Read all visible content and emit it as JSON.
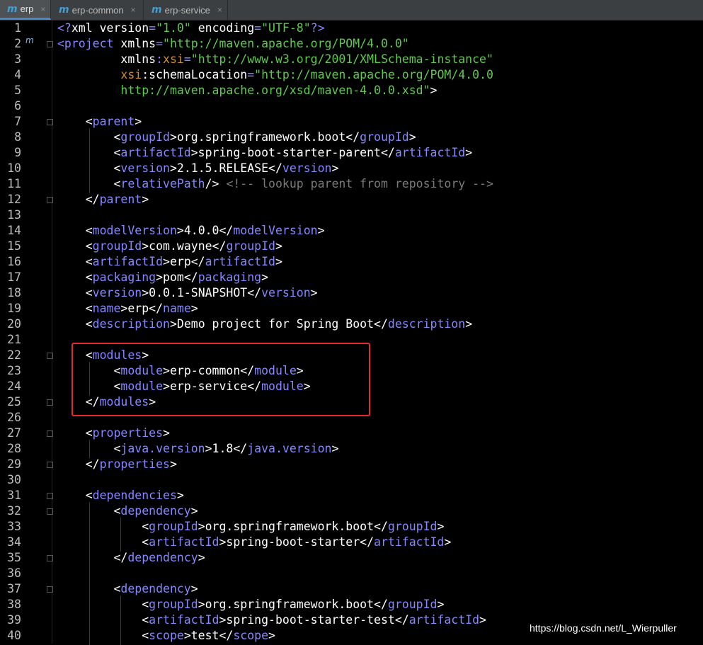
{
  "tabs": [
    {
      "label": "erp",
      "icon": "maven-m-icon",
      "active": true
    },
    {
      "label": "erp-common",
      "icon": "maven-m-icon",
      "active": false
    },
    {
      "label": "erp-service",
      "icon": "maven-m-icon",
      "active": false
    }
  ],
  "close_glyph": "×",
  "gutter_marker": "m",
  "watermark": "https://blog.csdn.net/L_Wierpuller",
  "colors": {
    "background": "#000000",
    "tag": "#8787ff",
    "string": "#5ec94d",
    "namespace": "#d08e3a",
    "comment": "#7a7a7a",
    "highlight": "#e6292b"
  },
  "lines": [
    {
      "n": "1",
      "tokens": [
        {
          "k": "t",
          "x": "<?"
        },
        {
          "k": "a",
          "x": "xml version"
        },
        {
          "k": "t",
          "x": "="
        },
        {
          "k": "s",
          "x": "\"1.0\""
        },
        {
          "k": "a",
          "x": " encoding"
        },
        {
          "k": "t",
          "x": "="
        },
        {
          "k": "s",
          "x": "\"UTF-8\""
        },
        {
          "k": "t",
          "x": "?>"
        }
      ]
    },
    {
      "n": "2",
      "tokens": [
        {
          "k": "t",
          "x": "<project"
        },
        {
          "k": "a",
          "x": " xmlns"
        },
        {
          "k": "t",
          "x": "="
        },
        {
          "k": "s",
          "x": "\"http://maven.apache.org/POM/4.0.0\""
        }
      ]
    },
    {
      "n": "3",
      "tokens": [
        {
          "k": "a",
          "x": "         xmlns"
        },
        {
          "k": "t",
          "x": ":"
        },
        {
          "k": "ns",
          "x": "xsi"
        },
        {
          "k": "t",
          "x": "="
        },
        {
          "k": "s",
          "x": "\"http://www.w3.org/2001/XMLSchema-instance\""
        }
      ]
    },
    {
      "n": "4",
      "tokens": [
        {
          "k": "ns",
          "x": "         xsi"
        },
        {
          "k": "a",
          "x": ":schemaLocation"
        },
        {
          "k": "t",
          "x": "="
        },
        {
          "k": "s",
          "x": "\"http://maven.apache.org/POM/4.0.0"
        }
      ]
    },
    {
      "n": "5",
      "tokens": [
        {
          "k": "s",
          "x": "         http://maven.apache.org/xsd/maven-4.0.0.xsd\""
        },
        {
          "k": "v",
          "x": ">"
        }
      ]
    },
    {
      "n": "6",
      "tokens": []
    },
    {
      "n": "7",
      "tokens": [
        {
          "k": "v",
          "x": "    <"
        },
        {
          "k": "t",
          "x": "parent"
        },
        {
          "k": "v",
          "x": ">"
        }
      ]
    },
    {
      "n": "8",
      "tokens": [
        {
          "k": "v",
          "x": "        <"
        },
        {
          "k": "t",
          "x": "groupId"
        },
        {
          "k": "v",
          "x": ">org.springframework.boot</"
        },
        {
          "k": "t",
          "x": "groupId"
        },
        {
          "k": "v",
          "x": ">"
        }
      ]
    },
    {
      "n": "9",
      "tokens": [
        {
          "k": "v",
          "x": "        <"
        },
        {
          "k": "t",
          "x": "artifactId"
        },
        {
          "k": "v",
          "x": ">spring-boot-starter-parent</"
        },
        {
          "k": "t",
          "x": "artifactId"
        },
        {
          "k": "v",
          "x": ">"
        }
      ]
    },
    {
      "n": "10",
      "tokens": [
        {
          "k": "v",
          "x": "        <"
        },
        {
          "k": "t",
          "x": "version"
        },
        {
          "k": "v",
          "x": ">2.1.5.RELEASE</"
        },
        {
          "k": "t",
          "x": "version"
        },
        {
          "k": "v",
          "x": ">"
        }
      ]
    },
    {
      "n": "11",
      "tokens": [
        {
          "k": "v",
          "x": "        <"
        },
        {
          "k": "t",
          "x": "relativePath"
        },
        {
          "k": "v",
          "x": "/> "
        },
        {
          "k": "c",
          "x": "<!-- lookup parent from repository -->"
        }
      ]
    },
    {
      "n": "12",
      "tokens": [
        {
          "k": "v",
          "x": "    </"
        },
        {
          "k": "t",
          "x": "parent"
        },
        {
          "k": "v",
          "x": ">"
        }
      ]
    },
    {
      "n": "13",
      "tokens": []
    },
    {
      "n": "14",
      "tokens": [
        {
          "k": "v",
          "x": "    <"
        },
        {
          "k": "t",
          "x": "modelVersion"
        },
        {
          "k": "v",
          "x": ">4.0.0</"
        },
        {
          "k": "t",
          "x": "modelVersion"
        },
        {
          "k": "v",
          "x": ">"
        }
      ]
    },
    {
      "n": "15",
      "tokens": [
        {
          "k": "v",
          "x": "    <"
        },
        {
          "k": "t",
          "x": "groupId"
        },
        {
          "k": "v",
          "x": ">com.wayne</"
        },
        {
          "k": "t",
          "x": "groupId"
        },
        {
          "k": "v",
          "x": ">"
        }
      ]
    },
    {
      "n": "16",
      "tokens": [
        {
          "k": "v",
          "x": "    <"
        },
        {
          "k": "t",
          "x": "artifactId"
        },
        {
          "k": "v",
          "x": ">erp</"
        },
        {
          "k": "t",
          "x": "artifactId"
        },
        {
          "k": "v",
          "x": ">"
        }
      ]
    },
    {
      "n": "17",
      "tokens": [
        {
          "k": "v",
          "x": "    <"
        },
        {
          "k": "t",
          "x": "packaging"
        },
        {
          "k": "v",
          "x": ">pom</"
        },
        {
          "k": "t",
          "x": "packaging"
        },
        {
          "k": "v",
          "x": ">"
        }
      ]
    },
    {
      "n": "18",
      "tokens": [
        {
          "k": "v",
          "x": "    <"
        },
        {
          "k": "t",
          "x": "version"
        },
        {
          "k": "v",
          "x": ">0.0.1-SNAPSHOT</"
        },
        {
          "k": "t",
          "x": "version"
        },
        {
          "k": "v",
          "x": ">"
        }
      ]
    },
    {
      "n": "19",
      "tokens": [
        {
          "k": "v",
          "x": "    <"
        },
        {
          "k": "t",
          "x": "name"
        },
        {
          "k": "v",
          "x": ">erp</"
        },
        {
          "k": "t",
          "x": "name"
        },
        {
          "k": "v",
          "x": ">"
        }
      ]
    },
    {
      "n": "20",
      "tokens": [
        {
          "k": "v",
          "x": "    <"
        },
        {
          "k": "t",
          "x": "description"
        },
        {
          "k": "v",
          "x": ">Demo project for Spring Boot</"
        },
        {
          "k": "t",
          "x": "description"
        },
        {
          "k": "v",
          "x": ">"
        }
      ]
    },
    {
      "n": "21",
      "tokens": []
    },
    {
      "n": "22",
      "tokens": [
        {
          "k": "v",
          "x": "    <"
        },
        {
          "k": "t",
          "x": "modules"
        },
        {
          "k": "v",
          "x": ">"
        }
      ]
    },
    {
      "n": "23",
      "tokens": [
        {
          "k": "v",
          "x": "        <"
        },
        {
          "k": "t",
          "x": "module"
        },
        {
          "k": "v",
          "x": ">erp-common</"
        },
        {
          "k": "t",
          "x": "module"
        },
        {
          "k": "v",
          "x": ">"
        }
      ]
    },
    {
      "n": "24",
      "tokens": [
        {
          "k": "v",
          "x": "        <"
        },
        {
          "k": "t",
          "x": "module"
        },
        {
          "k": "v",
          "x": ">erp-service</"
        },
        {
          "k": "t",
          "x": "module"
        },
        {
          "k": "v",
          "x": ">"
        }
      ]
    },
    {
      "n": "25",
      "tokens": [
        {
          "k": "v",
          "x": "    </"
        },
        {
          "k": "t",
          "x": "modules"
        },
        {
          "k": "v",
          "x": ">"
        }
      ]
    },
    {
      "n": "26",
      "tokens": []
    },
    {
      "n": "27",
      "tokens": [
        {
          "k": "v",
          "x": "    <"
        },
        {
          "k": "t",
          "x": "properties"
        },
        {
          "k": "v",
          "x": ">"
        }
      ]
    },
    {
      "n": "28",
      "tokens": [
        {
          "k": "v",
          "x": "        <"
        },
        {
          "k": "t",
          "x": "java.version"
        },
        {
          "k": "v",
          "x": ">1.8</"
        },
        {
          "k": "t",
          "x": "java.version"
        },
        {
          "k": "v",
          "x": ">"
        }
      ]
    },
    {
      "n": "29",
      "tokens": [
        {
          "k": "v",
          "x": "    </"
        },
        {
          "k": "t",
          "x": "properties"
        },
        {
          "k": "v",
          "x": ">"
        }
      ]
    },
    {
      "n": "30",
      "tokens": []
    },
    {
      "n": "31",
      "tokens": [
        {
          "k": "v",
          "x": "    <"
        },
        {
          "k": "t",
          "x": "dependencies"
        },
        {
          "k": "v",
          "x": ">"
        }
      ]
    },
    {
      "n": "32",
      "tokens": [
        {
          "k": "v",
          "x": "        <"
        },
        {
          "k": "t",
          "x": "dependency"
        },
        {
          "k": "v",
          "x": ">"
        }
      ]
    },
    {
      "n": "33",
      "tokens": [
        {
          "k": "v",
          "x": "            <"
        },
        {
          "k": "t",
          "x": "groupId"
        },
        {
          "k": "v",
          "x": ">org.springframework.boot</"
        },
        {
          "k": "t",
          "x": "groupId"
        },
        {
          "k": "v",
          "x": ">"
        }
      ]
    },
    {
      "n": "34",
      "tokens": [
        {
          "k": "v",
          "x": "            <"
        },
        {
          "k": "t",
          "x": "artifactId"
        },
        {
          "k": "v",
          "x": ">spring-boot-starter</"
        },
        {
          "k": "t",
          "x": "artifactId"
        },
        {
          "k": "v",
          "x": ">"
        }
      ]
    },
    {
      "n": "35",
      "tokens": [
        {
          "k": "v",
          "x": "        </"
        },
        {
          "k": "t",
          "x": "dependency"
        },
        {
          "k": "v",
          "x": ">"
        }
      ]
    },
    {
      "n": "36",
      "tokens": []
    },
    {
      "n": "37",
      "tokens": [
        {
          "k": "v",
          "x": "        <"
        },
        {
          "k": "t",
          "x": "dependency"
        },
        {
          "k": "v",
          "x": ">"
        }
      ]
    },
    {
      "n": "38",
      "tokens": [
        {
          "k": "v",
          "x": "            <"
        },
        {
          "k": "t",
          "x": "groupId"
        },
        {
          "k": "v",
          "x": ">org.springframework.boot</"
        },
        {
          "k": "t",
          "x": "groupId"
        },
        {
          "k": "v",
          "x": ">"
        }
      ]
    },
    {
      "n": "39",
      "tokens": [
        {
          "k": "v",
          "x": "            <"
        },
        {
          "k": "t",
          "x": "artifactId"
        },
        {
          "k": "v",
          "x": ">spring-boot-starter-test</"
        },
        {
          "k": "t",
          "x": "artifactId"
        },
        {
          "k": "v",
          "x": ">"
        }
      ]
    },
    {
      "n": "40",
      "tokens": [
        {
          "k": "v",
          "x": "            <"
        },
        {
          "k": "t",
          "x": "scope"
        },
        {
          "k": "v",
          "x": ">test</"
        },
        {
          "k": "t",
          "x": "scope"
        },
        {
          "k": "v",
          "x": ">"
        }
      ]
    }
  ]
}
